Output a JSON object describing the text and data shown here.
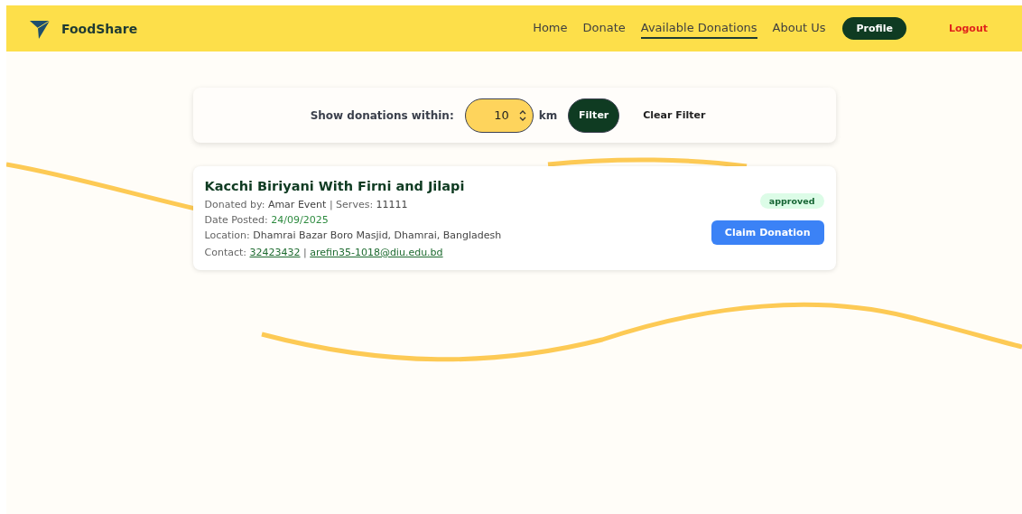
{
  "navbar": {
    "brand": "FoodShare",
    "links": [
      {
        "label": "Home",
        "selected": false
      },
      {
        "label": "Donate",
        "selected": false
      },
      {
        "label": "Available Donations",
        "selected": true
      },
      {
        "label": "About Us",
        "selected": false
      }
    ],
    "profile_button": "Profile",
    "logout": "Logout"
  },
  "filter": {
    "label": "Show donations within:",
    "value": "10",
    "unit": "km",
    "filter_button": "Filter",
    "clear_button": "Clear Filter"
  },
  "donations": [
    {
      "title": "Kacchi Biriyani With Firni and Jilapi",
      "donated_by_label": "Donated by:",
      "donor": "Amar Event",
      "separator": "|",
      "serves_label": "Serves:",
      "serves": "11111",
      "date_label": "Date Posted:",
      "date": "24/09/2025",
      "location_label": "Location:",
      "location": "Dhamrai Bazar Boro Masjid, Dhamrai, Bangladesh",
      "contact_label": "Contact:",
      "phone": "32423432",
      "contact_separator": "|",
      "email": "arefin35-1018@diu.edu.bd",
      "status": "approved",
      "claim_button": "Claim Donation"
    }
  ]
}
